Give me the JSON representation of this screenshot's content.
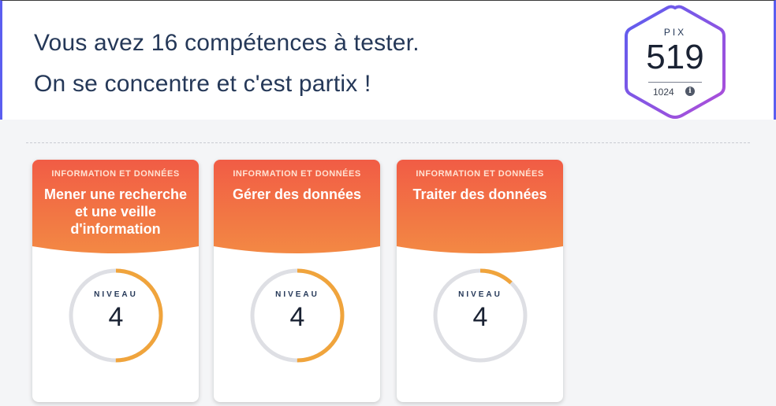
{
  "hero": {
    "line1": "Vous avez 16 compétences à tester.",
    "line2": "On se concentre et c'est partix !"
  },
  "pix": {
    "label": "PIX",
    "score": "519",
    "max": "1024",
    "info_icon": "info-icon",
    "colors": {
      "from": "#5b5ef0",
      "to": "#b04ed8"
    }
  },
  "cards": [
    {
      "area": "INFORMATION ET DONNÉES",
      "title": "Mener une recherche et une veille d'information",
      "level_label": "NIVEAU",
      "level": "4",
      "progress": 0.5
    },
    {
      "area": "INFORMATION ET DONNÉES",
      "title": "Gérer des données",
      "level_label": "NIVEAU",
      "level": "4",
      "progress": 0.5
    },
    {
      "area": "INFORMATION ET DONNÉES",
      "title": "Traiter des données",
      "level_label": "NIVEAU",
      "level": "4",
      "progress": 0.12
    }
  ],
  "colors": {
    "card_gradient_top": "#f15c45",
    "card_gradient_bottom": "#f38b44",
    "gauge_track": "#dedfe4",
    "gauge_fill": "#f0a43c"
  }
}
